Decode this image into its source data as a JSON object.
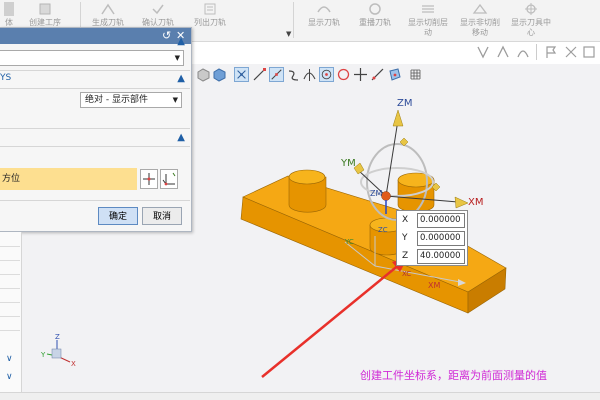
{
  "ribbon": {
    "buttons": [
      {
        "label": "体"
      },
      {
        "label": "创建工序"
      },
      {
        "label": "生成刀轨"
      },
      {
        "label": "确认刀轨"
      },
      {
        "label": "列出刀轨"
      },
      {
        "label": "显示刀轨"
      },
      {
        "label": "重播刀轨"
      },
      {
        "label": "显示切削层",
        "sub": "动"
      },
      {
        "label": "显示非切削",
        "sub": "移动"
      },
      {
        "label": "显示刀具中",
        "sub": "心"
      }
    ]
  },
  "dialog": {
    "section2_title": "YS",
    "reference_select": "绝对 - 显示部件",
    "orient_label": "方位",
    "ok_label": "确定",
    "cancel_label": "取消"
  },
  "coord_input": {
    "x_label": "X",
    "x_value": "0.000000",
    "y_label": "Y",
    "y_value": "0.000000",
    "z_label": "Z",
    "z_value": "40.00000"
  },
  "axes": {
    "zm": "ZM",
    "ym": "YM",
    "xm": "XM",
    "zm_small": "ZM",
    "xc": "XC",
    "yc": "YC",
    "zc": "ZC",
    "xm_small": "XM",
    "triad_z": "Z",
    "triad_y": "Y",
    "triad_x": "X"
  },
  "caption": "创建工件坐标系，距离为前面测量的值",
  "colors": {
    "part_orange": "#f0a010",
    "dialog_title": "#5a7fae",
    "highlight_row": "#fddf90",
    "caption": "#d02bd6",
    "arrow_red": "#e8302a"
  }
}
